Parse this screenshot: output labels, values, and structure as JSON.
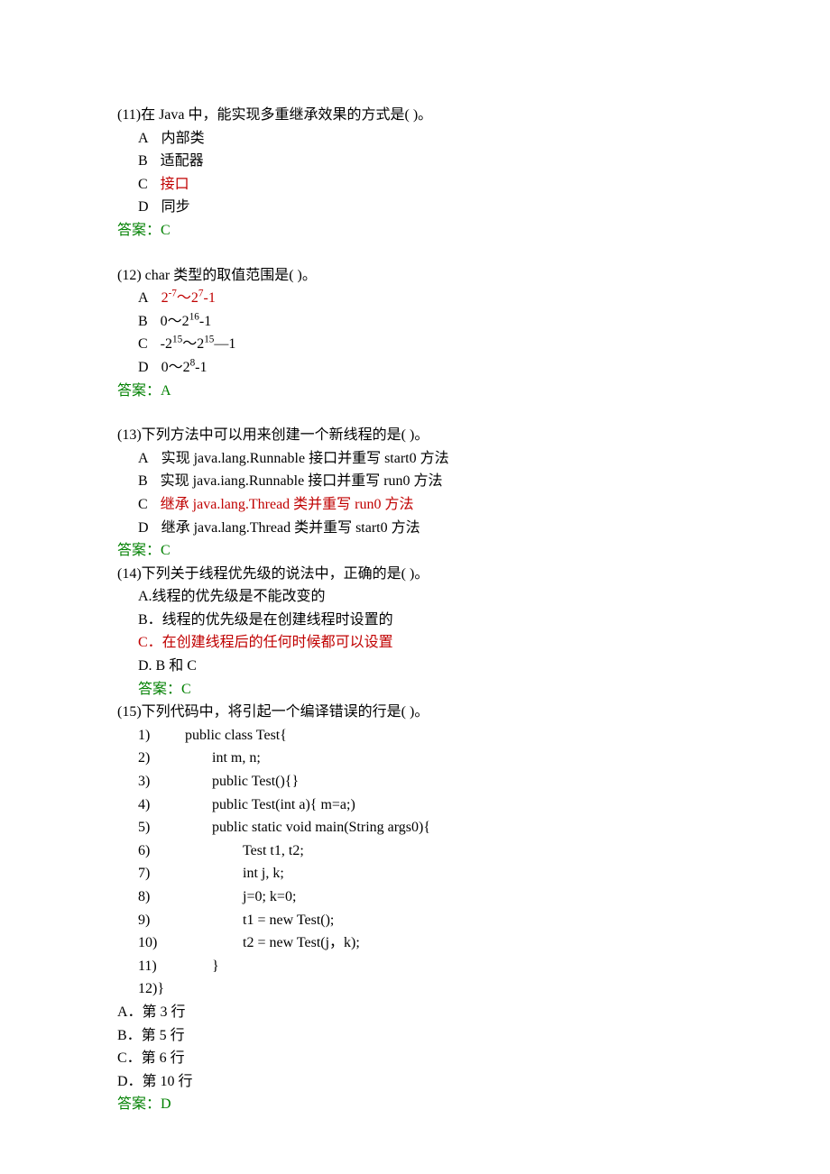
{
  "q11": {
    "stem": "(11)在 Java 中，能实现多重继承效果的方式是(    )。",
    "opts": {
      "A": {
        "letter": "A",
        "text": "内部类",
        "hl": false
      },
      "B": {
        "letter": "B",
        "text": "适配器",
        "hl": false
      },
      "C": {
        "letter": "C",
        "text": "接口",
        "hl": true
      },
      "D": {
        "letter": "D",
        "text": "同步",
        "hl": false
      }
    },
    "ans": "答案：C"
  },
  "q12": {
    "stem": "(12) char 类型的取值范围是(    )。",
    "opts": {
      "A": {
        "letter": "A",
        "pre": "2",
        "sup1": "-7",
        "mid": "～2",
        "sup2": "7",
        "post": "-1",
        "hl": true
      },
      "B": {
        "letter": "B",
        "pre": "0～2",
        "sup1": "16",
        "mid": "",
        "sup2": "",
        "post": "-1",
        "hl": false
      },
      "C": {
        "letter": "C",
        "pre": "-2",
        "sup1": "15",
        "mid": "～2",
        "sup2": "15",
        "post": "—1",
        "hl": false
      },
      "D": {
        "letter": "D",
        "pre": "0～2",
        "sup1": "8",
        "mid": "",
        "sup2": "",
        "post": "-1",
        "hl": false
      }
    },
    "ans": "答案：A"
  },
  "q13": {
    "stem": "(13)下列方法中可以用来创建一个新线程的是(    )。",
    "opts": {
      "A": {
        "letter": "A",
        "text": "实现 java.lang.Runnable 接口并重写 start0 方法",
        "hl": false
      },
      "B": {
        "letter": "B",
        "text": "实现 java.iang.Runnable 接口并重写 run0 方法",
        "hl": false
      },
      "C": {
        "letter": "C",
        "text": "继承 java.lang.Thread 类并重写 run0 方法",
        "hl": true
      },
      "D": {
        "letter": "D",
        "text": "继承 java.lang.Thread 类并重写 start0 方法",
        "hl": false
      }
    },
    "ans": "答案：C"
  },
  "q14": {
    "stem": "(14)下列关于线程优先级的说法中，正确的是(    )。",
    "opts": {
      "A": {
        "text": "A.线程的优先级是不能改变的",
        "hl": false
      },
      "B": {
        "text": "B．线程的优先级是在创建线程时设置的",
        "hl": false
      },
      "C": {
        "text": "C．在创建线程后的任何时候都可以设置",
        "hl": true
      },
      "D": {
        "text": "D. B 和 C",
        "hl": false
      }
    },
    "ans": "答案：C"
  },
  "q15": {
    "stem": "(15)下列代码中，将引起一个编译错误的行是(    )。",
    "code": {
      "l1": {
        "num": "1)",
        "text": "public class Test{",
        "ind": "code-inner-1"
      },
      "l2": {
        "num": "2)",
        "text": "int m, n;",
        "ind": "code-inner-2"
      },
      "l3": {
        "num": "3)",
        "text": "public Test(){}",
        "ind": "code-inner-2"
      },
      "l4": {
        "num": "4)",
        "text": "public Test(int a){ m=a;)",
        "ind": "code-inner-2"
      },
      "l5": {
        "num": "5)",
        "text": "public static void main(String args0){",
        "ind": "code-inner-2"
      },
      "l6": {
        "num": "6)",
        "text": "Test t1, t2;",
        "ind": "code-inner-3"
      },
      "l7": {
        "num": "7)",
        "text": "int j, k;",
        "ind": "code-inner-3"
      },
      "l8": {
        "num": "8)",
        "text": "j=0; k=0;",
        "ind": "code-inner-3"
      },
      "l9": {
        "num": "9)",
        "text": "t1 = new Test();",
        "ind": "code-inner-3"
      },
      "l10": {
        "num": "10)",
        "text": "t2 = new Test(j，k);",
        "ind": "code-inner-3"
      },
      "l11": {
        "num": "11)",
        "text": "}",
        "ind": "code-inner-2"
      },
      "l12": {
        "num": "12)}",
        "text": "",
        "ind": "code-inner-1"
      }
    },
    "opts": {
      "A": "A．第 3 行",
      "B": "B．第 5 行",
      "C": "C．第 6 行",
      "D": "D．第 10 行"
    },
    "ans": "答案：D"
  }
}
